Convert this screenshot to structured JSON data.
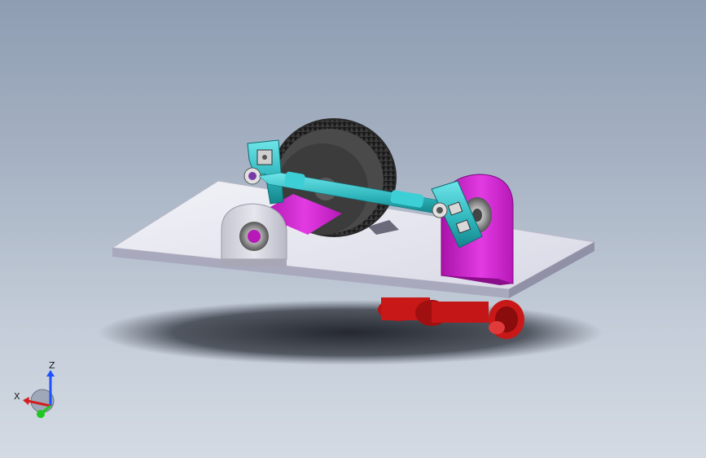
{
  "viewport": {
    "background_top": "#8e9db2",
    "background_bottom": "#d3dae3"
  },
  "model": {
    "parts": [
      {
        "name": "base-plate",
        "color": "#e6e6f0"
      },
      {
        "name": "saw-blade",
        "color": "#3a3a3a"
      },
      {
        "name": "drive-shaft",
        "color": "#3fc8cf"
      },
      {
        "name": "left-bearing-block",
        "color": "#d6d6de"
      },
      {
        "name": "right-bearing-block",
        "color": "#cc22cc"
      },
      {
        "name": "spindle-shaft",
        "color": "#d020d0"
      },
      {
        "name": "teal-bracket",
        "color": "#1ea6a6"
      },
      {
        "name": "motor-pulleys",
        "color": "#c81818"
      }
    ]
  },
  "triad": {
    "x_label": "X",
    "z_label": "Z",
    "x_color": "#d21e1e",
    "y_color": "#1ec81e",
    "z_color": "#1e50ff"
  }
}
